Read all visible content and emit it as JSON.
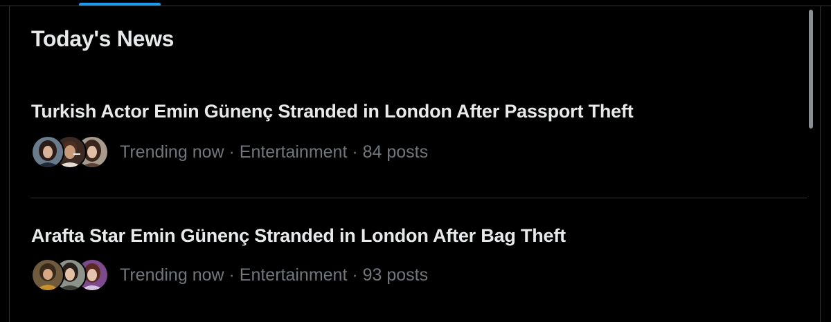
{
  "section": {
    "title": "Today's News"
  },
  "news": [
    {
      "headline": "Turkish Actor Emin Günenç Stranded in London After Passport Theft",
      "meta": "Trending now · Entertainment · 84 posts",
      "avatars": [
        "avatar",
        "avatar",
        "avatar"
      ]
    },
    {
      "headline": "Arafta Star Emin Günenç Stranded in London After Bag Theft",
      "meta": "Trending now · Entertainment · 93 posts",
      "avatars": [
        "avatar",
        "avatar",
        "avatar"
      ]
    }
  ],
  "colors": {
    "background": "#000000",
    "text_primary": "#e7e9ea",
    "text_secondary": "#71767b",
    "divider": "#2f3336",
    "accent": "#1d9bf0"
  }
}
